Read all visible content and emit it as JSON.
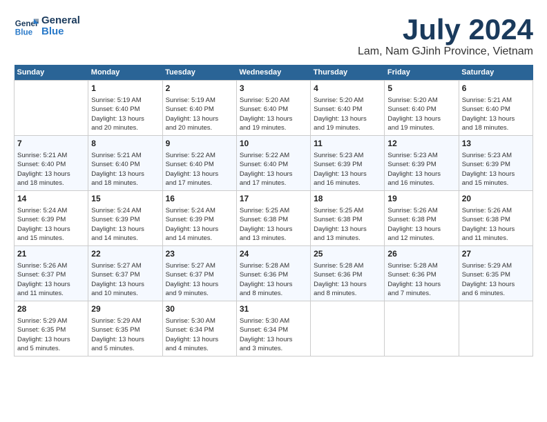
{
  "header": {
    "logo_line1": "General",
    "logo_line2": "Blue",
    "month": "July 2024",
    "location": "Lam, Nam GJinh Province, Vietnam"
  },
  "weekdays": [
    "Sunday",
    "Monday",
    "Tuesday",
    "Wednesday",
    "Thursday",
    "Friday",
    "Saturday"
  ],
  "weeks": [
    [
      {
        "day": "",
        "info": ""
      },
      {
        "day": "1",
        "info": "Sunrise: 5:19 AM\nSunset: 6:40 PM\nDaylight: 13 hours\nand 20 minutes."
      },
      {
        "day": "2",
        "info": "Sunrise: 5:19 AM\nSunset: 6:40 PM\nDaylight: 13 hours\nand 20 minutes."
      },
      {
        "day": "3",
        "info": "Sunrise: 5:20 AM\nSunset: 6:40 PM\nDaylight: 13 hours\nand 19 minutes."
      },
      {
        "day": "4",
        "info": "Sunrise: 5:20 AM\nSunset: 6:40 PM\nDaylight: 13 hours\nand 19 minutes."
      },
      {
        "day": "5",
        "info": "Sunrise: 5:20 AM\nSunset: 6:40 PM\nDaylight: 13 hours\nand 19 minutes."
      },
      {
        "day": "6",
        "info": "Sunrise: 5:21 AM\nSunset: 6:40 PM\nDaylight: 13 hours\nand 18 minutes."
      }
    ],
    [
      {
        "day": "7",
        "info": "Sunrise: 5:21 AM\nSunset: 6:40 PM\nDaylight: 13 hours\nand 18 minutes."
      },
      {
        "day": "8",
        "info": "Sunrise: 5:21 AM\nSunset: 6:40 PM\nDaylight: 13 hours\nand 18 minutes."
      },
      {
        "day": "9",
        "info": "Sunrise: 5:22 AM\nSunset: 6:40 PM\nDaylight: 13 hours\nand 17 minutes."
      },
      {
        "day": "10",
        "info": "Sunrise: 5:22 AM\nSunset: 6:40 PM\nDaylight: 13 hours\nand 17 minutes."
      },
      {
        "day": "11",
        "info": "Sunrise: 5:23 AM\nSunset: 6:39 PM\nDaylight: 13 hours\nand 16 minutes."
      },
      {
        "day": "12",
        "info": "Sunrise: 5:23 AM\nSunset: 6:39 PM\nDaylight: 13 hours\nand 16 minutes."
      },
      {
        "day": "13",
        "info": "Sunrise: 5:23 AM\nSunset: 6:39 PM\nDaylight: 13 hours\nand 15 minutes."
      }
    ],
    [
      {
        "day": "14",
        "info": "Sunrise: 5:24 AM\nSunset: 6:39 PM\nDaylight: 13 hours\nand 15 minutes."
      },
      {
        "day": "15",
        "info": "Sunrise: 5:24 AM\nSunset: 6:39 PM\nDaylight: 13 hours\nand 14 minutes."
      },
      {
        "day": "16",
        "info": "Sunrise: 5:24 AM\nSunset: 6:39 PM\nDaylight: 13 hours\nand 14 minutes."
      },
      {
        "day": "17",
        "info": "Sunrise: 5:25 AM\nSunset: 6:38 PM\nDaylight: 13 hours\nand 13 minutes."
      },
      {
        "day": "18",
        "info": "Sunrise: 5:25 AM\nSunset: 6:38 PM\nDaylight: 13 hours\nand 13 minutes."
      },
      {
        "day": "19",
        "info": "Sunrise: 5:26 AM\nSunset: 6:38 PM\nDaylight: 13 hours\nand 12 minutes."
      },
      {
        "day": "20",
        "info": "Sunrise: 5:26 AM\nSunset: 6:38 PM\nDaylight: 13 hours\nand 11 minutes."
      }
    ],
    [
      {
        "day": "21",
        "info": "Sunrise: 5:26 AM\nSunset: 6:37 PM\nDaylight: 13 hours\nand 11 minutes."
      },
      {
        "day": "22",
        "info": "Sunrise: 5:27 AM\nSunset: 6:37 PM\nDaylight: 13 hours\nand 10 minutes."
      },
      {
        "day": "23",
        "info": "Sunrise: 5:27 AM\nSunset: 6:37 PM\nDaylight: 13 hours\nand 9 minutes."
      },
      {
        "day": "24",
        "info": "Sunrise: 5:28 AM\nSunset: 6:36 PM\nDaylight: 13 hours\nand 8 minutes."
      },
      {
        "day": "25",
        "info": "Sunrise: 5:28 AM\nSunset: 6:36 PM\nDaylight: 13 hours\nand 8 minutes."
      },
      {
        "day": "26",
        "info": "Sunrise: 5:28 AM\nSunset: 6:36 PM\nDaylight: 13 hours\nand 7 minutes."
      },
      {
        "day": "27",
        "info": "Sunrise: 5:29 AM\nSunset: 6:35 PM\nDaylight: 13 hours\nand 6 minutes."
      }
    ],
    [
      {
        "day": "28",
        "info": "Sunrise: 5:29 AM\nSunset: 6:35 PM\nDaylight: 13 hours\nand 5 minutes."
      },
      {
        "day": "29",
        "info": "Sunrise: 5:29 AM\nSunset: 6:35 PM\nDaylight: 13 hours\nand 5 minutes."
      },
      {
        "day": "30",
        "info": "Sunrise: 5:30 AM\nSunset: 6:34 PM\nDaylight: 13 hours\nand 4 minutes."
      },
      {
        "day": "31",
        "info": "Sunrise: 5:30 AM\nSunset: 6:34 PM\nDaylight: 13 hours\nand 3 minutes."
      },
      {
        "day": "",
        "info": ""
      },
      {
        "day": "",
        "info": ""
      },
      {
        "day": "",
        "info": ""
      }
    ]
  ]
}
